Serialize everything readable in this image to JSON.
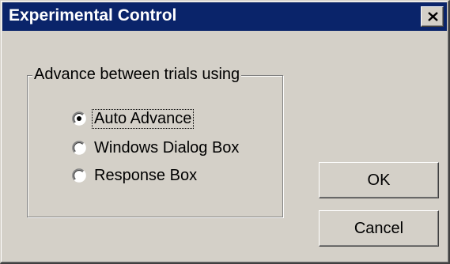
{
  "window": {
    "title": "Experimental Control"
  },
  "titlebar": {
    "close_icon": "close-icon"
  },
  "group": {
    "legend": "Advance between trials using",
    "options": [
      {
        "label": "Auto Advance",
        "selected": true
      },
      {
        "label": "Windows Dialog Box",
        "selected": false
      },
      {
        "label": "Response Box",
        "selected": false
      }
    ]
  },
  "buttons": {
    "ok_label": "OK",
    "cancel_label": "Cancel"
  },
  "colors": {
    "titlebar": "#0a246a",
    "face": "#d4d0c8"
  }
}
